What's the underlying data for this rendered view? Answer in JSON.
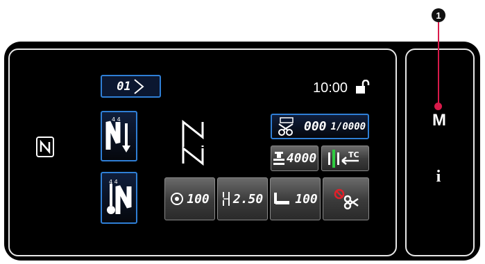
{
  "callout": {
    "number": "1"
  },
  "side_panel": {
    "mode_key": "M",
    "info_key": "i"
  },
  "screen": {
    "top_button": "01",
    "time": "10:00",
    "counter": {
      "main": "000",
      "sub": "1/0000"
    },
    "bobbin_counter": "4000",
    "thread_tension": "100",
    "stitch_length": "2.50",
    "presser_pressure": "100",
    "tc_label": "TC"
  },
  "colors": {
    "accent": "#2f7fd6",
    "callout": "#d81a4a",
    "thread_cut_red": "#e0202a"
  }
}
